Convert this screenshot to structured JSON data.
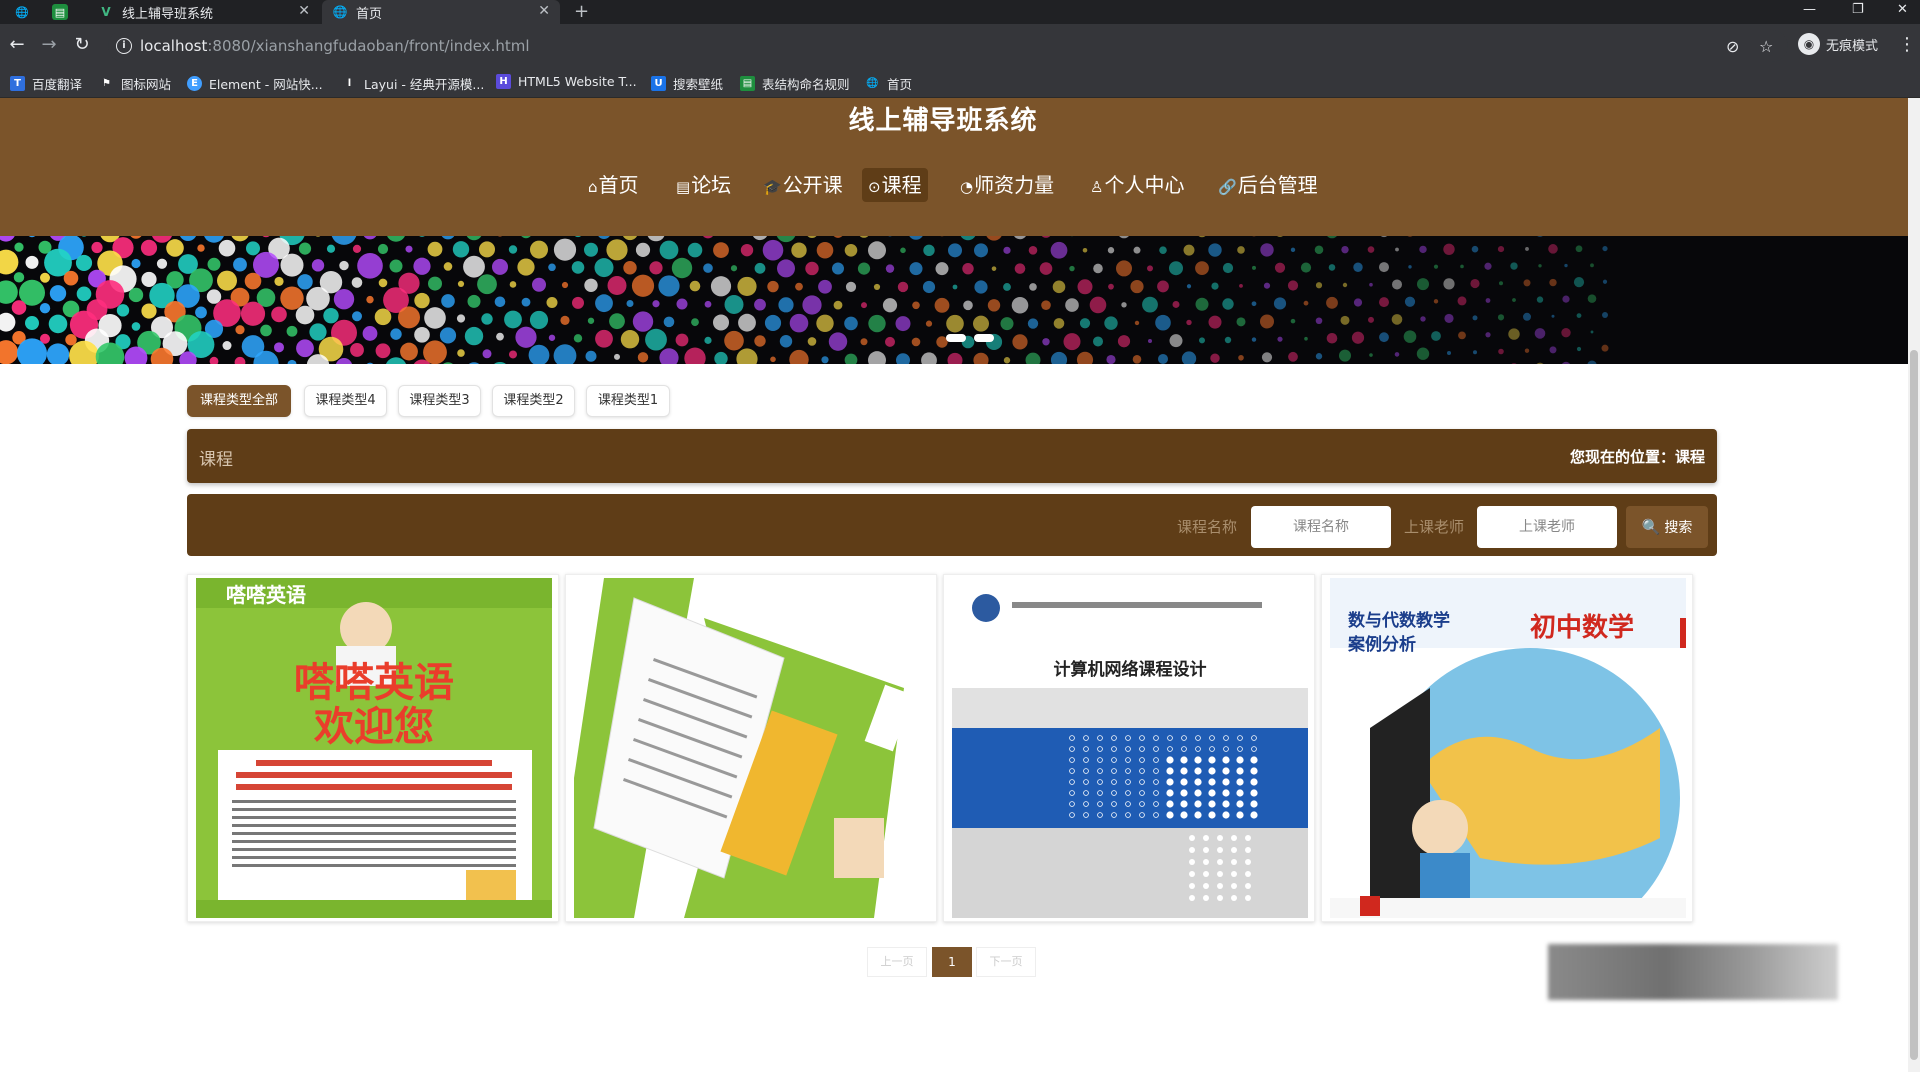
{
  "browser": {
    "tabs": [
      {
        "label": "线上辅导班系统",
        "active": false
      },
      {
        "label": "首页",
        "active": true
      }
    ],
    "url_host": "localhost",
    "url_path": ":8080/xianshangfudaoban/front/index.html",
    "incognito_label": "无痕模式",
    "bookmarks": [
      "百度翻译",
      "图标网站",
      "Element - 网站快...",
      "Layui - 经典开源模...",
      "HTML5 Website T...",
      "搜索壁纸",
      "表结构命名规则",
      "首页"
    ]
  },
  "site": {
    "title": "线上辅导班系统",
    "nav": [
      {
        "label": "首页",
        "icon": "home-icon",
        "active": false
      },
      {
        "label": "论坛",
        "icon": "forum-icon",
        "active": false
      },
      {
        "label": "公开课",
        "icon": "graduation-cap-icon",
        "active": false
      },
      {
        "label": "课程",
        "icon": "course-icon",
        "active": true
      },
      {
        "label": "师资力量",
        "icon": "teacher-icon",
        "active": false
      },
      {
        "label": "个人中心",
        "icon": "user-icon",
        "active": false
      },
      {
        "label": "后台管理",
        "icon": "link-icon",
        "active": false
      }
    ]
  },
  "category_tabs": [
    "课程类型全部",
    "课程类型4",
    "课程类型3",
    "课程类型2",
    "课程类型1"
  ],
  "breadcrumb": {
    "title": "课程",
    "location_prefix": "您现在的位置：",
    "location_current": "课程"
  },
  "search": {
    "name_label": "课程名称",
    "name_placeholder": "课程名称",
    "teacher_label": "上课老师",
    "teacher_placeholder": "上课老师",
    "button_label": "搜索"
  },
  "courses": [
    {
      "image": "嗒嗒英语 欢迎您",
      "brand": "嗒嗒英语",
      "tagline": "嗒嗒英语",
      "tagline2": "欢迎您"
    },
    {
      "image": "嗒嗒英语 flyer rotated"
    },
    {
      "image": "计算机网络课程设计",
      "book_title": "计算机网络课程设计"
    },
    {
      "image": "初中数学 数与代数教学案例分析",
      "book_title": "初中数学",
      "book_subtitle": "数与代数教学",
      "book_subtitle2": "案例分析"
    }
  ],
  "pagination": {
    "prev": "上一页",
    "current": "1",
    "next": "下一页"
  }
}
